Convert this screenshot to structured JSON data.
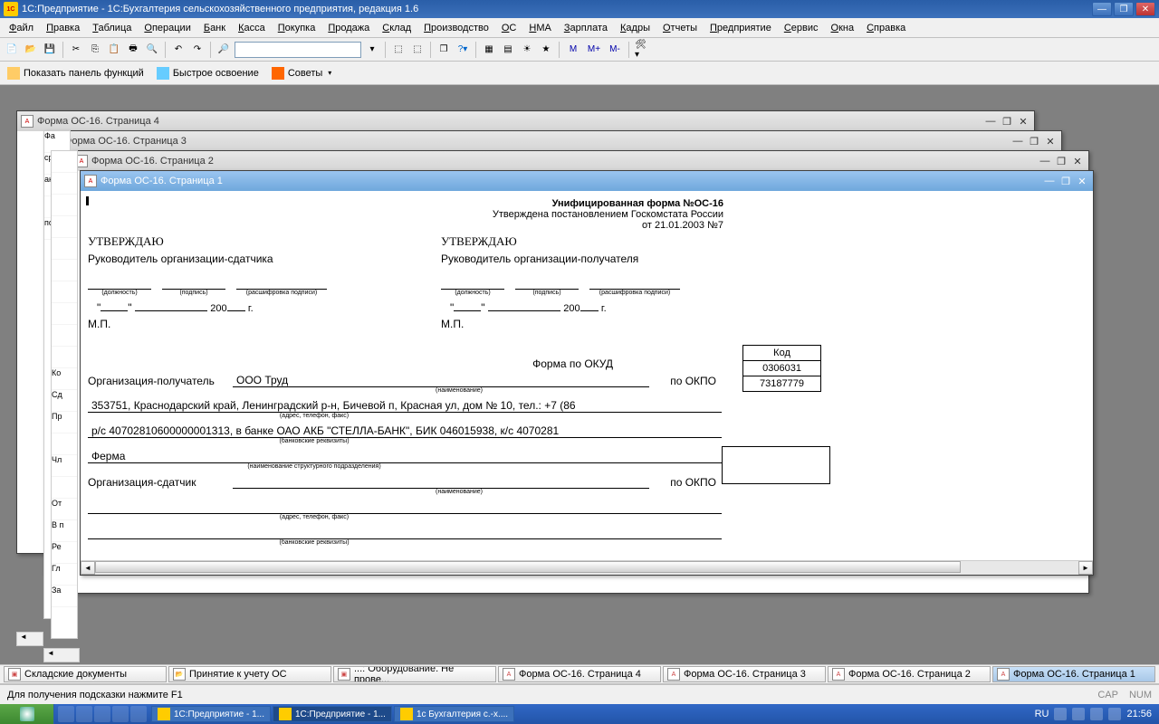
{
  "title": "1С:Предприятие - 1С:Бухгалтерия сельскохозяйственного предприятия, редакция 1.6",
  "menu": [
    "Файл",
    "Правка",
    "Таблица",
    "Операции",
    "Банк",
    "Касса",
    "Покупка",
    "Продажа",
    "Склад",
    "Производство",
    "ОС",
    "НМА",
    "Зарплата",
    "Кадры",
    "Отчеты",
    "Предприятие",
    "Сервис",
    "Окна",
    "Справка"
  ],
  "toolbar2": {
    "funcpanel": "Показать панель функций",
    "fast": "Быстрое освоение",
    "tips": "Советы"
  },
  "tb_m": [
    "M",
    "M+",
    "M-"
  ],
  "windows": {
    "w4": "Форма ОС-16. Страница 4",
    "w3": "Форма ОС-16. Страница 3",
    "w2": "Форма ОС-16. Страница 2",
    "w1": "Форма ОС-16. Страница 1"
  },
  "form": {
    "hdr1": "Унифицированная форма №ОС-16",
    "hdr2": "Утверждена постановлением Госкомстата России",
    "hdr3": "от 21.01.2003 №7",
    "approve": "УТВЕРЖДАЮ",
    "chief_sender": "Руководитель организации-сдатчика",
    "chief_recv": "Руководитель организации-получателя",
    "sig_pos": "(должность)",
    "sig_sign": "(подпись)",
    "sig_dec": "(расшифровка подписи)",
    "year": "200",
    "yearl": "г.",
    "mp": "М.П.",
    "code_hdr": "Код",
    "okud_lbl": "Форма по ОКУД",
    "okud": "0306031",
    "okpo_lbl": "по ОКПО",
    "okpo": "73187779",
    "org_recv_lbl": "Организация-получатель",
    "org_recv": "ООО Труд",
    "name_tiny": "(наименование)",
    "addr": "353751, Краснодарский край, Ленинградский р-н, Бичевой п, Красная ул, дом № 10, тел.: +7 (86",
    "addr_tiny": "(адрес, телефон, факс)",
    "bank": "р/с 40702810600000001313, в банке ОАО АКБ \"СТЕЛЛА-БАНК\", БИК 046015938, к/с 4070281",
    "bank_tiny": "(банковские реквизиты)",
    "ferma": "Ферма",
    "dept_tiny": "(наименование структурного подразделения)",
    "org_send_lbl": "Организация-сдатчик"
  },
  "tasks": [
    {
      "label": "Складские документы",
      "icon": "doc"
    },
    {
      "label": "Принятие к учету ОС",
      "icon": "folder"
    },
    {
      "label": "...: Оборудование. Не прове...",
      "icon": "doc"
    },
    {
      "label": "Форма ОС-16. Страница 4",
      "icon": "A"
    },
    {
      "label": "Форма ОС-16. Страница 3",
      "icon": "A"
    },
    {
      "label": "Форма ОС-16. Страница 2",
      "icon": "A"
    },
    {
      "label": "Форма ОС-16. Страница 1",
      "icon": "A",
      "sel": true
    }
  ],
  "status": {
    "hint": "Для получения подсказки нажмите F1",
    "cap": "CAP",
    "num": "NUM"
  },
  "wintasks": [
    {
      "label": "1С:Предприятие - 1...",
      "icon": "1c"
    },
    {
      "label": "1С:Предприятие - 1...",
      "icon": "1c",
      "act": true
    },
    {
      "label": "1с Бухгалтерия с.-х....",
      "icon": "w"
    }
  ],
  "tray": {
    "lang": "RU",
    "time": "21:56"
  },
  "side1": [
    "Фа",
    "ср",
    "ан",
    " ",
    "по"
  ],
  "side2": [
    " ",
    " ",
    " ",
    " ",
    " ",
    " ",
    " ",
    " ",
    " ",
    " ",
    "Ко",
    "Сд",
    "Пр",
    " ",
    "Чл",
    " ",
    "От",
    "В п",
    "Ре",
    "Гл",
    "За"
  ]
}
